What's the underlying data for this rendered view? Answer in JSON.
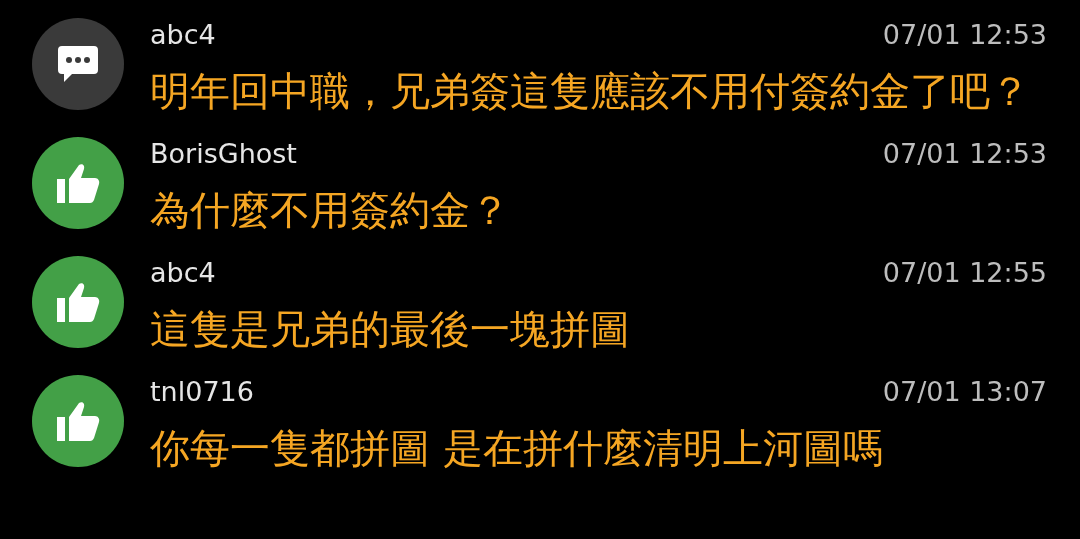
{
  "comments": [
    {
      "kind": "comment",
      "user": "abc4",
      "time": "07/01 12:53",
      "text": "明年回中職，兄弟簽這隻應該不用付簽約金了吧？"
    },
    {
      "kind": "push",
      "user": "BorisGhost",
      "time": "07/01 12:53",
      "text": "為什麼不用簽約金？"
    },
    {
      "kind": "push",
      "user": "abc4",
      "time": "07/01 12:55",
      "text": "這隻是兄弟的最後一塊拼圖"
    },
    {
      "kind": "push",
      "user": "tnl0716",
      "time": "07/01 13:07",
      "text": "你每一隻都拼圖 是在拼什麼清明上河圖嗎"
    }
  ]
}
